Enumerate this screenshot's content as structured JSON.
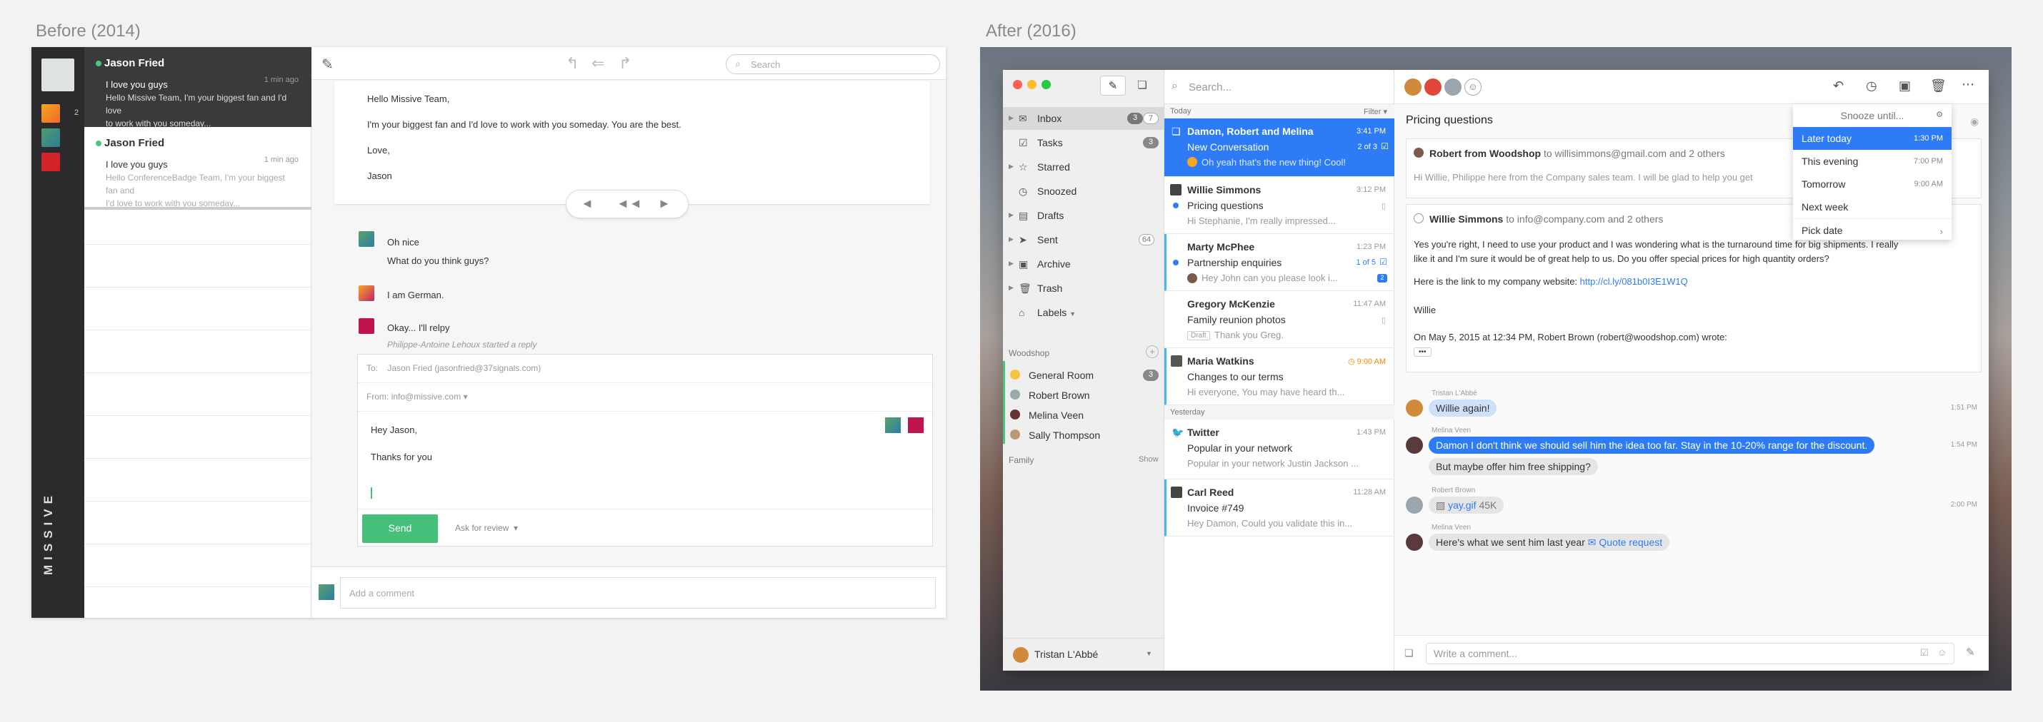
{
  "before": {
    "title": "Before (2014)",
    "brand": "MISSIVE",
    "rail_count": "2",
    "list": [
      {
        "name": "Jason Fried",
        "time": "1 min ago",
        "subject": "I love you guys",
        "preview_1": "Hello Missive Team, I'm your biggest fan and I'd love",
        "preview_2": "to work with you someday..."
      },
      {
        "name": "Jason Fried",
        "time": "1 min ago",
        "subject": "I love you guys",
        "preview_1": "Hello ConferenceBadge Team, I'm your biggest fan and",
        "preview_2": "I'd love to work with you someday..."
      }
    ],
    "search_placeholder": "Search",
    "email": {
      "greeting": "Hello Missive Team,",
      "body": "I'm your biggest fan and I'd love to work with you someday. You are the best.",
      "closing": "Love,",
      "signature": "Jason"
    },
    "comments": [
      {
        "line1": "Oh nice",
        "line2": "What do you think guys?"
      },
      {
        "line1": "I am German.",
        "line2": ""
      },
      {
        "line1": "Okay... I'll relpy",
        "line2": ""
      }
    ],
    "typing_note": "Philippe-Antoine Lehoux started a reply",
    "composer": {
      "to_label": "To:",
      "to_value": "Jason Fried (jasonfried@37signals.com)",
      "from_label": "From:",
      "from_value": "info@missive.com",
      "line1": "Hey Jason,",
      "line2": "Thanks for you",
      "send": "Send",
      "review": "Ask for review"
    },
    "comment_placeholder": "Add a comment"
  },
  "after": {
    "title": "After (2016)",
    "sidebar": [
      {
        "label": "Inbox",
        "icon": "inbox-icon",
        "badges": [
          "3",
          "7"
        ]
      },
      {
        "label": "Tasks",
        "icon": "tasks-icon",
        "badges": [
          "3"
        ]
      },
      {
        "label": "Starred",
        "icon": "star-icon",
        "badges": []
      },
      {
        "label": "Snoozed",
        "icon": "clock-icon",
        "badges": []
      },
      {
        "label": "Drafts",
        "icon": "drafts-icon",
        "badges": []
      },
      {
        "label": "Sent",
        "icon": "sent-icon",
        "badges": [
          "64"
        ]
      },
      {
        "label": "Archive",
        "icon": "archive-icon",
        "badges": []
      },
      {
        "label": "Trash",
        "icon": "trash-icon",
        "badges": []
      },
      {
        "label": "Labels",
        "icon": "label-icon",
        "badges": []
      }
    ],
    "org_label": "Woodshop",
    "rooms": [
      {
        "label": "General Room",
        "badge": "3"
      },
      {
        "label": "Robert Brown",
        "badge": ""
      },
      {
        "label": "Melina Veen",
        "badge": ""
      },
      {
        "label": "Sally Thompson",
        "badge": ""
      }
    ],
    "family_label": "Family",
    "family_show": "Show",
    "user": "Tristan L'Abbé",
    "search_placeholder": "Search...",
    "today": "Today",
    "filter": "Filter",
    "yesterday": "Yesterday",
    "messages": [
      {
        "name": "Damon, Robert and Melina",
        "subject": "New Conversation",
        "preview": "Oh yeah that's the new thing! Cool!",
        "time": "3:41 PM",
        "count": "2 of 3"
      },
      {
        "name": "Willie Simmons",
        "subject": "Pricing questions",
        "preview": "Hi Stephanie, I'm really impressed...",
        "time": "3:12 PM",
        "count": ""
      },
      {
        "name": "Marty McPhee",
        "subject": "Partnership enquiries",
        "preview": "Hey John can you please look i...",
        "time": "1:23 PM",
        "count": "1 of 5"
      },
      {
        "name": "Gregory McKenzie",
        "subject": "Family reunion photos",
        "preview": "Thank you Greg.",
        "time": "11:47 AM",
        "count": "",
        "draft": "Draft"
      },
      {
        "name": "Maria Watkins",
        "subject": "Changes to our terms",
        "preview": "Hi everyone, You may have heard th...",
        "time": "9:00 AM",
        "count": ""
      },
      {
        "name": "Twitter",
        "subject": "Popular in your network",
        "preview": "Popular in your network Justin Jackson ...",
        "time": "1:43 PM",
        "count": ""
      },
      {
        "name": "Carl Reed",
        "subject": "Invoice #749",
        "preview": "Hey Damon, Could you validate this in...",
        "time": "11:28 AM",
        "count": ""
      }
    ],
    "conversation": {
      "title": "Pricing questions",
      "email1": {
        "from": "Robert from Woodshop",
        "to": "to willisimmons@gmail.com and 2 others",
        "preview": "Hi Willie, Philippe here from the Company sales team. I will be glad to help you get"
      },
      "email2": {
        "from": "Willie Simmons",
        "to": "to info@company.com and 2 others",
        "line1": "Yes you're right, I need to use your product and I was wondering what is the turnaround time for big shipments. I really",
        "line2": "like it and I'm sure it would be of great help to us. Do you offer special prices for high quantity orders?",
        "link_text": "Here is the link to my company website:",
        "link": "http://cl.ly/081b0I3E1W1Q",
        "sign": "Willie",
        "quote": "On May 5, 2015 at 12:34 PM, Robert Brown (robert@woodshop.com) wrote:",
        "more": "•••"
      },
      "chat": [
        {
          "author": "Tristan L'Abbé",
          "text": "Willie again!",
          "time": "1:51 PM"
        },
        {
          "author": "Melina Veen",
          "text": "Damon I don't think we should sell him the idea too far. Stay in the 10-20% range for the discount.",
          "time": "1:54 PM"
        },
        {
          "author": "",
          "text": "But maybe offer him free shipping?",
          "time": ""
        },
        {
          "author": "Robert Brown",
          "text": "yay.gif",
          "size": "45K",
          "time": "2:00 PM"
        },
        {
          "author": "Melina Veen",
          "text": "Here's what we sent him last year",
          "link": "Quote request",
          "time": ""
        }
      ],
      "comment_placeholder": "Write a comment..."
    },
    "snooze": {
      "title": "Snooze until...",
      "options": [
        {
          "label": "Later today",
          "time": "1:30 PM"
        },
        {
          "label": "This evening",
          "time": "7:00 PM"
        },
        {
          "label": "Tomorrow",
          "time": "9:00 AM"
        },
        {
          "label": "Next week",
          "time": ""
        },
        {
          "label": "Pick date",
          "time": ""
        }
      ]
    }
  }
}
